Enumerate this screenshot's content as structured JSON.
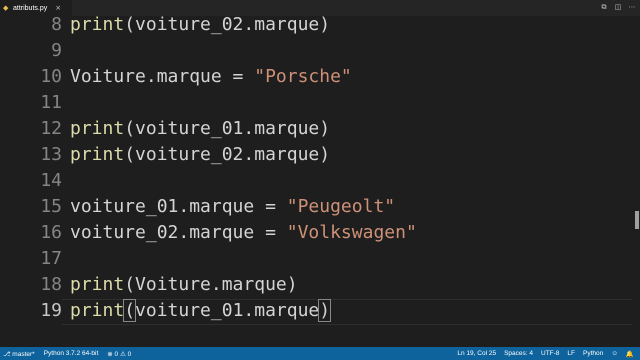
{
  "tab": {
    "icon": "python-file-icon",
    "filename": "attributs.py",
    "close": "×"
  },
  "tab_actions": [
    "⧉",
    "◫",
    "⋯"
  ],
  "editor": {
    "active_line": "19",
    "lines": [
      {
        "num": "8",
        "tokens": [
          {
            "t": "print",
            "c": "fn"
          },
          {
            "t": "(voiture_02.marque)",
            "c": ""
          }
        ]
      },
      {
        "num": "9",
        "tokens": []
      },
      {
        "num": "10",
        "tokens": [
          {
            "t": "Voiture.marque = ",
            "c": ""
          },
          {
            "t": "\"Porsche\"",
            "c": "str"
          }
        ]
      },
      {
        "num": "11",
        "tokens": []
      },
      {
        "num": "12",
        "tokens": [
          {
            "t": "print",
            "c": "fn"
          },
          {
            "t": "(voiture_01.marque)",
            "c": ""
          }
        ]
      },
      {
        "num": "13",
        "tokens": [
          {
            "t": "print",
            "c": "fn"
          },
          {
            "t": "(voiture_02.marque)",
            "c": ""
          }
        ]
      },
      {
        "num": "14",
        "tokens": []
      },
      {
        "num": "15",
        "tokens": [
          {
            "t": "voiture_01.marque = ",
            "c": ""
          },
          {
            "t": "\"Peugeolt\"",
            "c": "str"
          }
        ]
      },
      {
        "num": "16",
        "tokens": [
          {
            "t": "voiture_02.marque = ",
            "c": ""
          },
          {
            "t": "\"Volkswagen\"",
            "c": "str"
          }
        ]
      },
      {
        "num": "17",
        "tokens": []
      },
      {
        "num": "18",
        "tokens": [
          {
            "t": "print",
            "c": "fn"
          },
          {
            "t": "(Voiture.marque)",
            "c": ""
          }
        ]
      },
      {
        "num": "19",
        "tokens": [
          {
            "t": "print",
            "c": "fn"
          },
          {
            "t": "(",
            "c": "br match"
          },
          {
            "t": "voiture_01.marque",
            "c": ""
          },
          {
            "t": ")",
            "c": "br match"
          }
        ]
      }
    ]
  },
  "status": {
    "branch": "master*",
    "interpreter": "Python 3.7.2 64-bit",
    "errors": "0",
    "warnings": "0",
    "position": "Ln 19, Col 25",
    "spaces": "Spaces: 4",
    "encoding": "UTF-8",
    "eol": "LF",
    "language": "Python",
    "bar_color": "#0e639c"
  }
}
